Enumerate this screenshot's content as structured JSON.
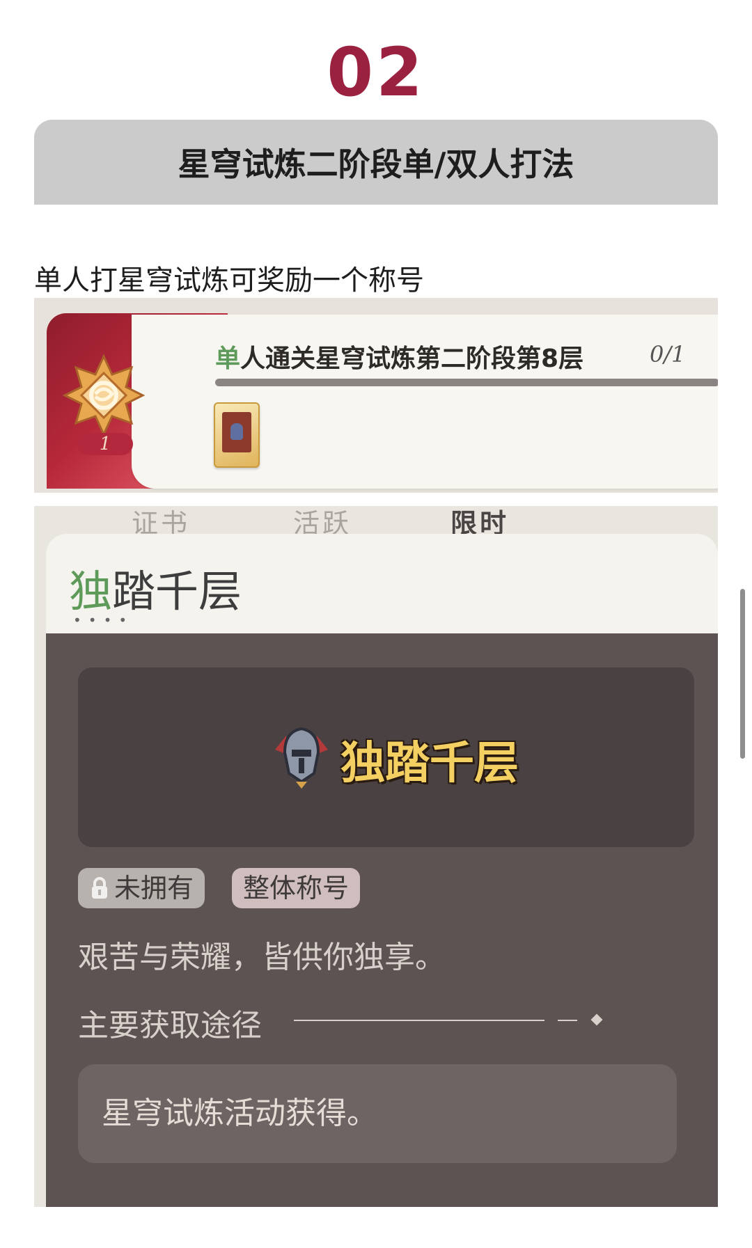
{
  "section_number": "02",
  "header": {
    "title": "星穹试炼二阶段单/双人打法"
  },
  "intro_text": "单人打星穹试炼可奖励一个称号",
  "achievement": {
    "badge_count": "1",
    "title_first_char": "单",
    "title_rest": "人通关星穹试炼第二阶段第8层",
    "progress_text": "0/1",
    "progress_fraction": 0,
    "accent_color": "#b3283c"
  },
  "title_detail": {
    "tabs": [
      "证书",
      "活跃",
      "限时"
    ],
    "name_first_char": "独",
    "name_rest": "踏千层",
    "dots": "••••",
    "preview_title": "独踏千层",
    "status_chip": "未拥有",
    "type_chip": "整体称号",
    "description": "艰苦与荣耀，皆供你独享。",
    "source_header": "主要获取途径",
    "source_text": "星穹试炼活动获得。",
    "preview_title_color": "#f4d063"
  }
}
